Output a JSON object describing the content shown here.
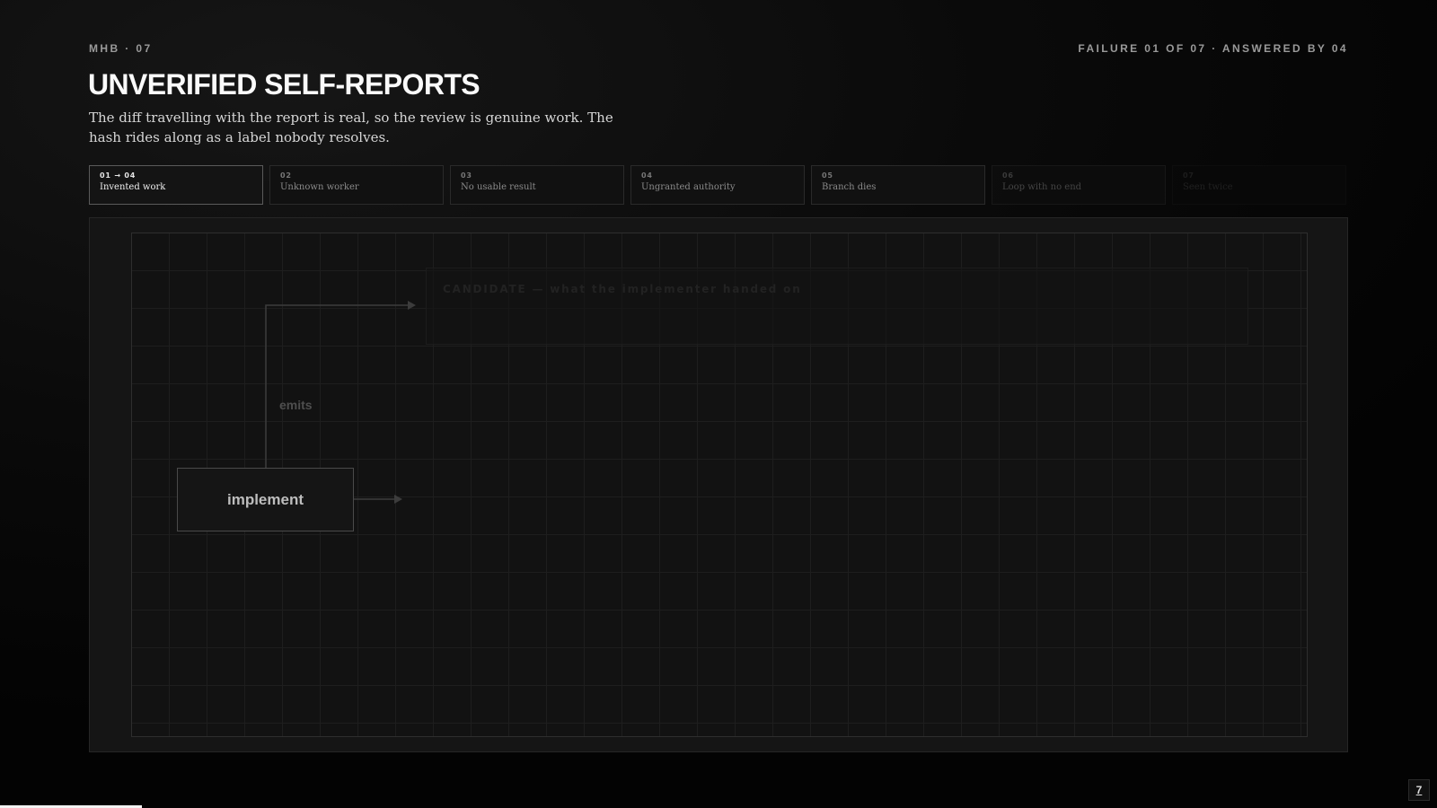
{
  "header": {
    "kicker": "MHB · 07",
    "failure_meta": "FAILURE 01 OF 07 · ANSWERED BY 04",
    "title": "UNVERIFIED SELF-REPORTS",
    "subtitle": "The diff travelling with the report is real, so the review is genuine work. The hash rides along as a label nobody resolves."
  },
  "tabs": [
    {
      "num": "01 → 04",
      "label": "Invented work",
      "active": true
    },
    {
      "num": "02",
      "label": "Unknown worker"
    },
    {
      "num": "03",
      "label": "No usable result"
    },
    {
      "num": "04",
      "label": "Ungranted authority"
    },
    {
      "num": "05",
      "label": "Branch dies"
    },
    {
      "num": "06",
      "label": "Loop with no end"
    },
    {
      "num": "07",
      "label": "Seen twice"
    }
  ],
  "diagram": {
    "candidate_caption": "CANDIDATE — what the implementer handed on",
    "edge_label": "emits",
    "node_implement": "implement"
  },
  "progress": {
    "fraction": 0.099
  },
  "corner": {
    "label": "7"
  },
  "colors": {
    "background": "#0a0a0a",
    "accent": "#f2f2f2",
    "muted": "#9a9a9a"
  }
}
